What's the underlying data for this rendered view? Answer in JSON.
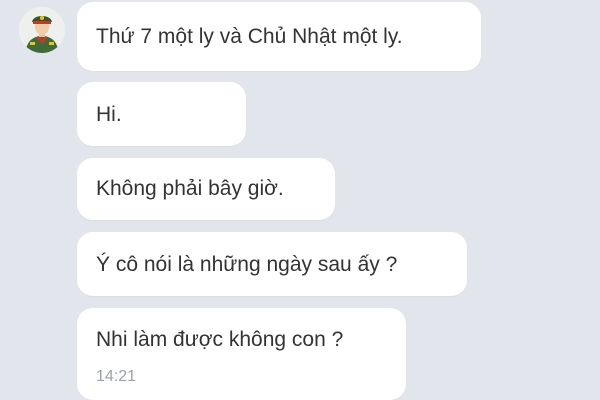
{
  "conversation": {
    "avatar": {
      "icon": "police-officer-avatar-icon"
    },
    "messages": [
      {
        "text": "Thứ 7 một ly và Chủ Nhật một ly."
      },
      {
        "text": "Hi."
      },
      {
        "text": "Không phải bây giờ."
      },
      {
        "text": "Ý cô nói là những ngày sau ấy ?"
      },
      {
        "text": "Nhi làm được không con ?",
        "time": "14:21"
      }
    ]
  },
  "colors": {
    "background": "#e3e5ec",
    "bubble": "#ffffff",
    "text": "#333333",
    "timestamp": "#9aa1a8"
  }
}
